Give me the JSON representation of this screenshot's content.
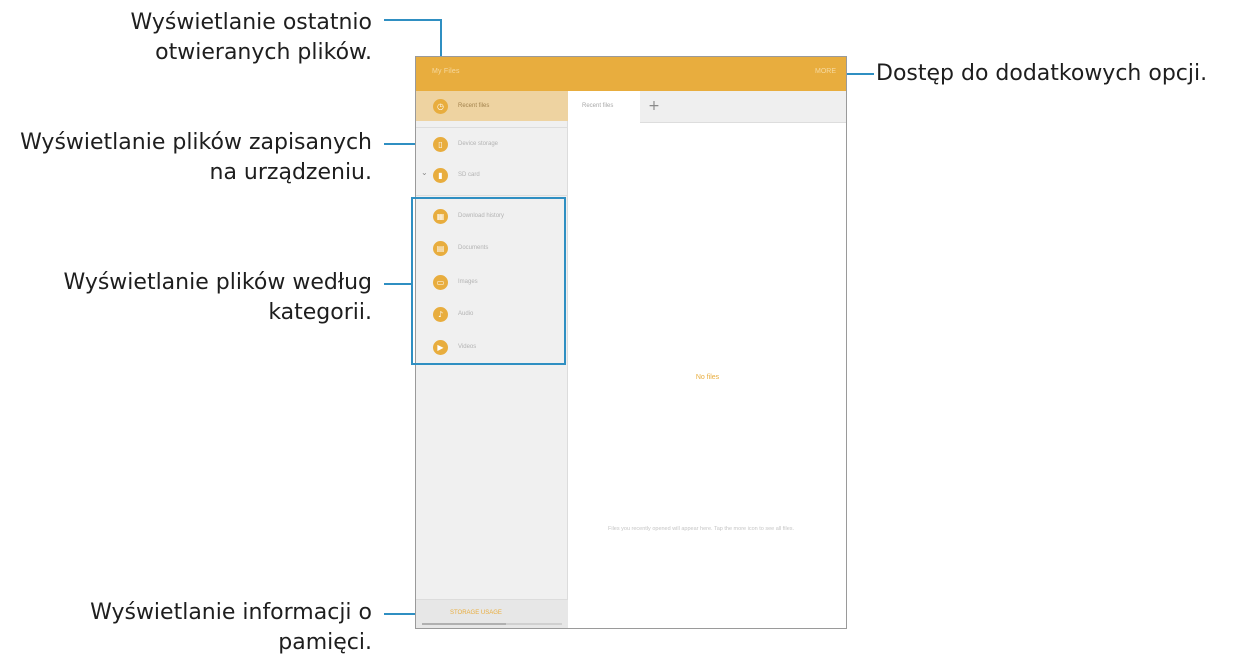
{
  "callouts": {
    "recent": [
      "Wyświetlanie ostatnio",
      "otwieranych plików."
    ],
    "device": [
      "Wyświetlanie plików zapisanych",
      "na urządzeniu."
    ],
    "category": [
      "Wyświetlanie plików według",
      "kategorii."
    ],
    "memory": [
      "Wyświetlanie informacji o",
      "pamięci."
    ],
    "options": "Dostęp do dodatkowych opcji."
  },
  "app": {
    "title": "My Files",
    "more": "MORE"
  },
  "sidebar": {
    "items": [
      {
        "label": "Recent files",
        "icon": "clock-icon",
        "glyph": "◷"
      },
      {
        "label": "Device storage",
        "icon": "phone-icon",
        "glyph": "▯"
      },
      {
        "label": "SD card",
        "icon": "sd-card-icon",
        "glyph": "▮"
      },
      {
        "label": "Download history",
        "icon": "download-history-icon",
        "glyph": "▦"
      },
      {
        "label": "Documents",
        "icon": "document-icon",
        "glyph": "▤"
      },
      {
        "label": "Images",
        "icon": "image-icon",
        "glyph": "▭"
      },
      {
        "label": "Audio",
        "icon": "music-note-icon",
        "glyph": "♪"
      },
      {
        "label": "Videos",
        "icon": "video-icon",
        "glyph": "▶"
      }
    ],
    "storage_label": "STORAGE USAGE"
  },
  "main": {
    "tab_label": "Recent files",
    "add_tab": "+",
    "empty_title": "No files",
    "empty_desc": "Files you recently opened will appear here. Tap the more icon to see all files."
  },
  "colors": {
    "accent": "#e8ad3e",
    "callout_line": "#2f8fc2"
  }
}
